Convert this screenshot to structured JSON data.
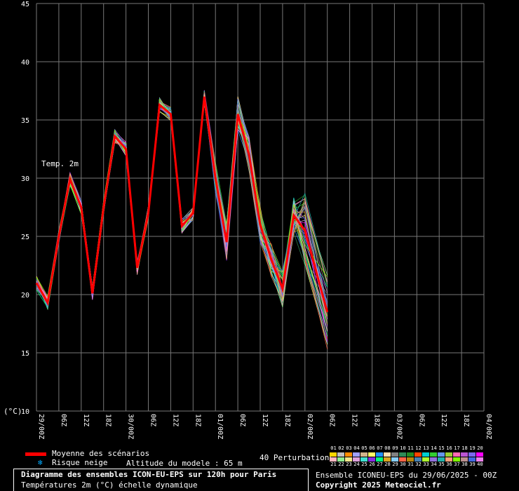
{
  "chart_data": {
    "type": "line",
    "title": "Diagramme des ensembles ICON-EU-EPS sur 120h pour Paris",
    "subtitle": "Températures 2m (°C) échelle dynamique",
    "ylabel": "(°C)",
    "annotation": "Temp. 2m",
    "ylim": [
      10,
      45
    ],
    "yticks": [
      10,
      15,
      20,
      25,
      30,
      35,
      40,
      45
    ],
    "x_hours": [
      0,
      3,
      6,
      9,
      12,
      15,
      18,
      21,
      24,
      27,
      30,
      33,
      36,
      39,
      42,
      45,
      48,
      51,
      54,
      57,
      60,
      63,
      66,
      69,
      72,
      78,
      84,
      90,
      96,
      102,
      108,
      114,
      120
    ],
    "xtick_labels": [
      "29/00Z",
      "06Z",
      "12Z",
      "18Z",
      "30/00Z",
      "06Z",
      "12Z",
      "18Z",
      "01/00Z",
      "06Z",
      "12Z",
      "18Z",
      "02/00Z",
      "06Z",
      "12Z",
      "18Z",
      "03/00Z",
      "06Z",
      "12Z",
      "18Z",
      "04/00Z"
    ],
    "grid": true,
    "mean": {
      "name": "Moyenne des scénarios",
      "color": "#ff0000",
      "values": [
        21.0,
        19.3,
        25.0,
        29.9,
        27.5,
        20.1,
        27.5,
        33.6,
        32.5,
        22.3,
        27.0,
        36.3,
        35.5,
        25.9,
        27.0,
        37.0,
        30.0,
        24.5,
        35.5,
        32.0,
        26.0,
        23.0,
        20.5,
        26.8,
        25.5,
        18.5,
        null,
        null,
        null,
        null,
        null,
        null,
        null
      ]
    },
    "members_count": 40
  },
  "legend": {
    "mean_label": "Moyenne des scénarios",
    "snow_label": "Risque neige",
    "altitude_label": "Altitude du modele : 65 m",
    "perturbations_label": "40 Perturbations"
  },
  "footer": {
    "title": "Diagramme des ensembles ICON-EU-EPS sur 120h pour Paris",
    "subtitle": "Températures 2m (°C) échelle dynamique",
    "ensemble": "Ensemble ICONEU-EPS du 29/06/2025 - 00Z",
    "copyright": "Copyright 2025 Meteociel.fr"
  },
  "perturbations": {
    "numbers": [
      "01",
      "02",
      "03",
      "04",
      "05",
      "06",
      "07",
      "08",
      "09",
      "10",
      "11",
      "12",
      "13",
      "14",
      "15",
      "16",
      "17",
      "18",
      "19",
      "20",
      "21",
      "22",
      "23",
      "24",
      "25",
      "26",
      "27",
      "28",
      "29",
      "30",
      "31",
      "32",
      "33",
      "34",
      "35",
      "36",
      "37",
      "38",
      "39",
      "40"
    ],
    "colors": [
      "#ffd700",
      "#c0c0c0",
      "#ff8c00",
      "#a0a0ff",
      "#d2b48c",
      "#ffff66",
      "#1e90ff",
      "#ffdead",
      "#808080",
      "#2e8b57",
      "#228b22",
      "#ff4500",
      "#00ced1",
      "#32cd32",
      "#6495ed",
      "#9acd32",
      "#ff69b4",
      "#ba55d3",
      "#7b68ee",
      "#ff00ff",
      "#ffb6c1",
      "#90ee90",
      "#f0e68c",
      "#dda0dd",
      "#40e0d0",
      "#8a2be2",
      "#00ff7f",
      "#daa520",
      "#87cefa",
      "#ff6347",
      "#b8860b",
      "#4682b4",
      "#adff2f",
      "#9370db",
      "#20b2aa",
      "#ffa07a",
      "#7fff00",
      "#bc8f8f",
      "#4169e1",
      "#ee82ee"
    ]
  }
}
